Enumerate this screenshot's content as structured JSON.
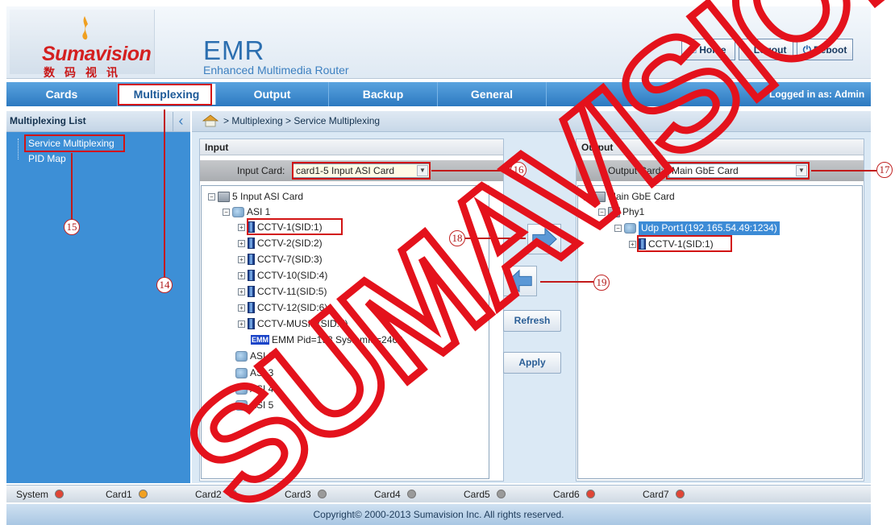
{
  "header": {
    "logo_text": "Sumavision",
    "logo_cn": "数码视讯",
    "brand_title": "EMR",
    "brand_subtitle": "Enhanced Multimedia Router",
    "buttons": [
      {
        "label": "Home",
        "icon": "home-icon"
      },
      {
        "label": "Logout",
        "icon": "user-icon"
      },
      {
        "label": "Reboot",
        "icon": "power-icon"
      }
    ]
  },
  "nav": {
    "tabs": [
      "Cards",
      "Multiplexing",
      "Output",
      "Backup",
      "General"
    ],
    "active": "Multiplexing",
    "logged_in": "Logged in as: Admin"
  },
  "sidebar": {
    "title": "Multiplexing List",
    "items": [
      "Service Multiplexing",
      "PID Map"
    ]
  },
  "breadcrumb": "> Multiplexing > Service Multiplexing",
  "input": {
    "title": "Input",
    "card_label": "Input Card:",
    "card_value": "card1-5 Input ASI Card",
    "tree": {
      "root": "5 Input ASI Card",
      "asi1": "ASI 1",
      "services": [
        "CCTV-1(SID:1)",
        "CCTV-2(SID:2)",
        "CCTV-7(SID:3)",
        "CCTV-10(SID:4)",
        "CCTV-11(SID:5)",
        "CCTV-12(SID:6)",
        "CCTV-MUSIC(SID:7)"
      ],
      "emm": "EMM Pid=193 SystemId=2460",
      "emm_tag": "EMM",
      "others": [
        "ASI 2",
        "ASI 3",
        "ASI 4",
        "ASI 5"
      ]
    }
  },
  "output": {
    "title": "Output",
    "card_label": "Output Card:",
    "card_value": "Main GbE Card",
    "tree": {
      "root": "Main GbE Card",
      "phy": "Phy1",
      "port": "Udp Port1(192.165.54.49:1234)",
      "service": "CCTV-1(SID:1)"
    }
  },
  "actions": {
    "refresh": "Refresh",
    "apply": "Apply"
  },
  "callouts": [
    "14",
    "15",
    "16",
    "17",
    "18",
    "19"
  ],
  "status": {
    "items": [
      {
        "label": "System",
        "color": "#e04535"
      },
      {
        "label": "Card1",
        "color": "#f2a020"
      },
      {
        "label": "Card2",
        "color": "#9a9a9a"
      },
      {
        "label": "Card3",
        "color": "#9a9a9a"
      },
      {
        "label": "Card4",
        "color": "#9a9a9a"
      },
      {
        "label": "Card5",
        "color": "#9a9a9a"
      },
      {
        "label": "Card6",
        "color": "#e04535"
      },
      {
        "label": "Card7",
        "color": "#e04535"
      }
    ]
  },
  "footer": "Copyright© 2000-2013 Sumavision Inc. All rights reserved.",
  "watermark": "SUMAVISION",
  "colors": {
    "accent": "#3d8fd6",
    "highlight": "#d21414",
    "selected_node": "#3c8bd6"
  }
}
